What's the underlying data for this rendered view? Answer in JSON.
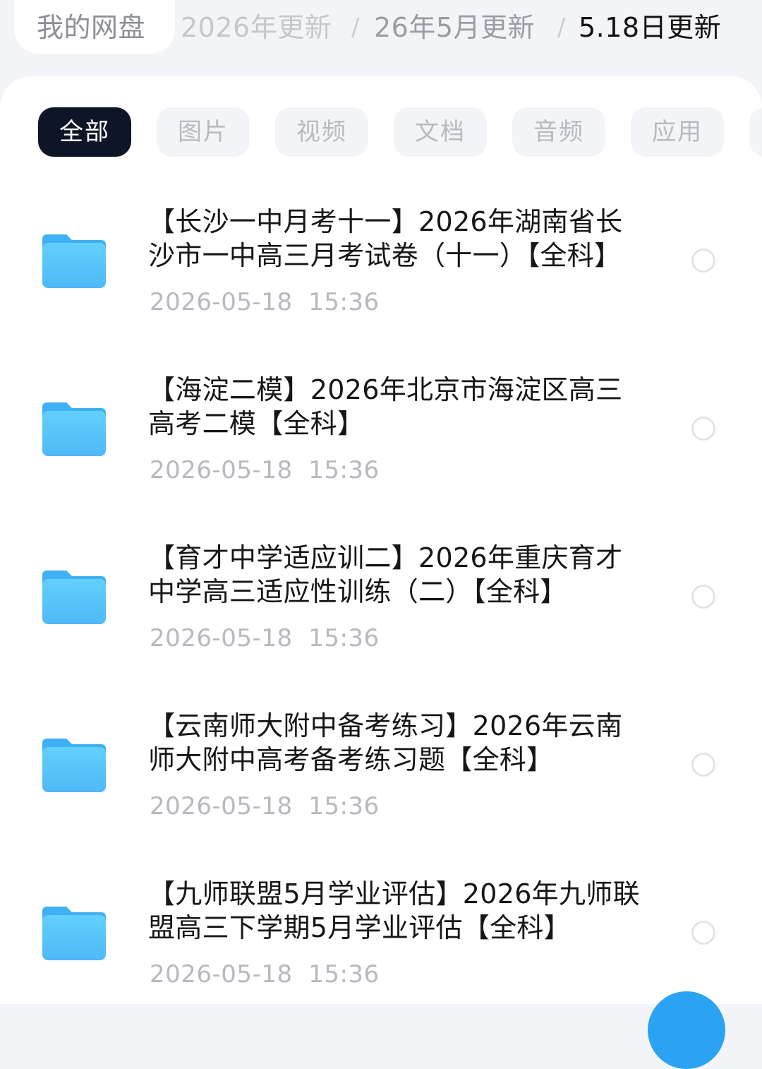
{
  "breadcrumb": {
    "root": "我的网盘",
    "level1": "2026年更新",
    "level2": "26年5月更新",
    "current": "5.18日更新",
    "separator": "/"
  },
  "filters": [
    {
      "label": "全部",
      "active": true
    },
    {
      "label": "图片",
      "active": false
    },
    {
      "label": "视频",
      "active": false
    },
    {
      "label": "文档",
      "active": false
    },
    {
      "label": "音频",
      "active": false
    },
    {
      "label": "应用",
      "active": false
    },
    {
      "label": "",
      "active": false
    }
  ],
  "files": [
    {
      "icon": "folder-icon",
      "name": "【长沙一中月考十一】2026年湖南省长沙市一中高三月考试卷（十一）【全科】",
      "date": "2026-05-18  15:36"
    },
    {
      "icon": "folder-icon",
      "name": "【海淀二模】2026年北京市海淀区高三高考二模【全科】",
      "date": "2026-05-18  15:36"
    },
    {
      "icon": "folder-icon",
      "name": "【育才中学适应训二】2026年重庆育才中学高三适应性训练（二）【全科】",
      "date": "2026-05-18  15:36"
    },
    {
      "icon": "folder-icon",
      "name": "【云南师大附中备考练习】2026年云南师大附中高考备考练习题【全科】",
      "date": "2026-05-18  15:36"
    },
    {
      "icon": "folder-icon",
      "name": "【九师联盟5月学业评估】2026年九师联盟高三下学期5月学业评估【全科】",
      "date": "2026-05-18  15:36"
    }
  ],
  "colors": {
    "background": "#f3f4f7",
    "card": "#ffffff",
    "active_chip": "#0d1526",
    "inactive_chip_text": "#b7bac0",
    "folder_blue": "#5ac8fa",
    "accent": "#2aa3f2"
  }
}
